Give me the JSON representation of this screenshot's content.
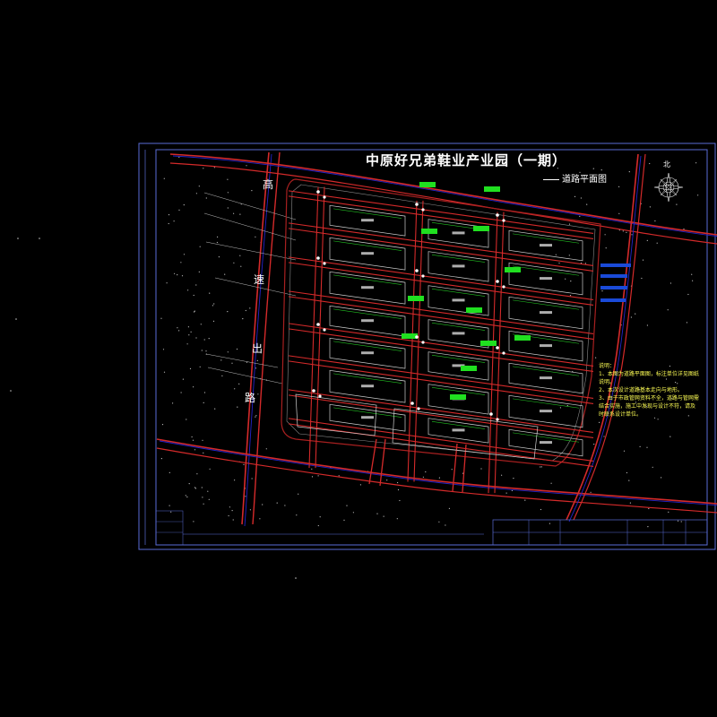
{
  "drawing": {
    "title": "中原好兄弟鞋业产业园（一期）",
    "subtitle": "道路平面图",
    "north_label": "北",
    "road_name_chars": [
      "高",
      "速",
      "出",
      "路"
    ],
    "notes": {
      "heading": "说明：",
      "items": [
        "1、本图为道路平面图，标注单位详见图纸说明。",
        "2、本次设计道路基本走向与地形。",
        "3、由于市政管网资料不全，道路与管网需结合实施，施工中发现与设计不符，请及时联系设计单位。"
      ]
    },
    "colors": {
      "background": "#000000",
      "frame": "#5a6dd6",
      "road_edge": "#d42a2a",
      "road_center": "#2424c8",
      "plot_outline": "#cfcfcf",
      "green_line": "#22c022",
      "green_label": "#20e020",
      "notes_text": "#ffff55",
      "title_text": "#ffffff"
    }
  }
}
